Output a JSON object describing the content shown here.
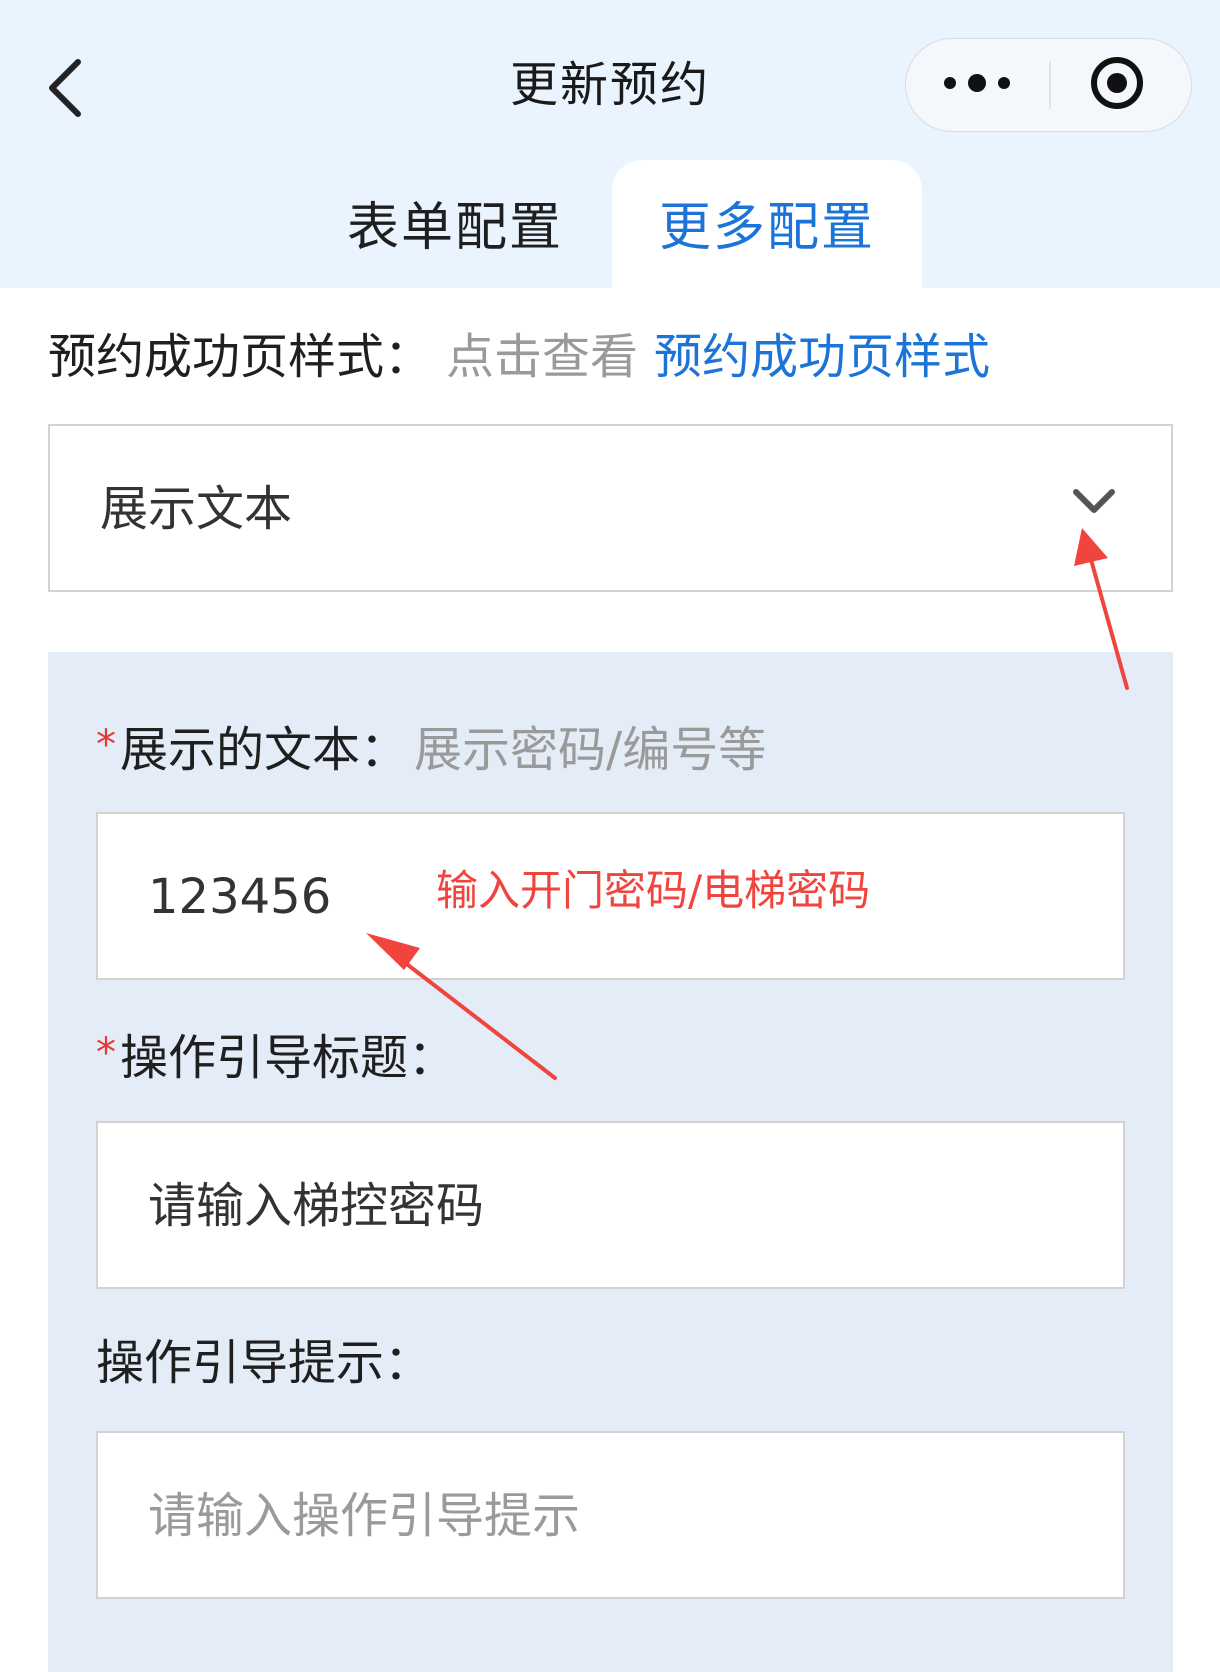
{
  "nav": {
    "title": "更新预约",
    "back_icon": "chevron-left-icon",
    "menu_icon": "more-dots-icon",
    "close_icon": "target-circle-icon"
  },
  "tabs": [
    {
      "label": "表单配置",
      "active": false
    },
    {
      "label": "更多配置",
      "active": true
    }
  ],
  "success_style": {
    "label": "预约成功页样式：",
    "hint": "点击查看",
    "link": "预约成功页样式"
  },
  "display_mode": {
    "value": "展示文本",
    "icon": "chevron-down-icon"
  },
  "fields": {
    "display_text": {
      "required_mark": "*",
      "label": "展示的文本：",
      "hint": "展示密码/编号等",
      "value": "123456"
    },
    "guide_title": {
      "required_mark": "*",
      "label": "操作引导标题：",
      "value": "请输入梯控密码"
    },
    "guide_tip": {
      "label": "操作引导提示：",
      "placeholder": "请输入操作引导提示"
    }
  },
  "annotation": {
    "text": "输入开门密码/电梯密码",
    "color": "#f0453e"
  },
  "colors": {
    "accent": "#1c74d8",
    "header_bg": "#e9f4fe",
    "panel_bg": "#e3ecf7",
    "required": "#e53935"
  }
}
